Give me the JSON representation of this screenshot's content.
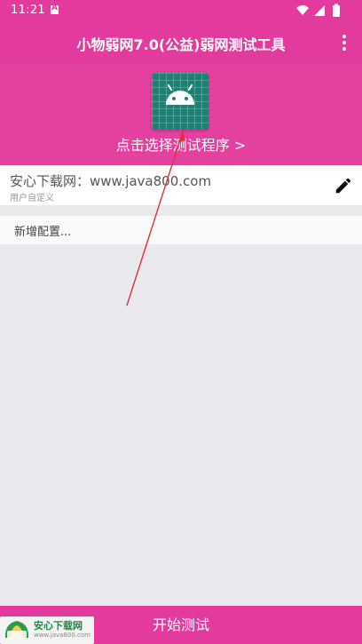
{
  "status_bar": {
    "time": "11:21",
    "icons": [
      "notification-icon",
      "wifi-icon",
      "signal-icon",
      "battery-icon"
    ]
  },
  "toolbar": {
    "title": "小物弱网7.0(公益)弱网测试工具",
    "menu_icon": "more-vert-icon"
  },
  "header": {
    "app_icon": "android-icon",
    "select_label": "点击选择测试程序 >"
  },
  "config": {
    "name": "安心下载网：www.java800.com",
    "subtitle": "用户自定义",
    "edit_icon": "pencil-icon"
  },
  "add_config": {
    "label": "新增配置..."
  },
  "footer": {
    "start_label": "开始测试"
  },
  "watermark": {
    "name": "安心下载网",
    "url": "www.java800.com"
  },
  "colors": {
    "primary": "#e33a9e",
    "header_bg": "#e4409f",
    "page_bg": "#e9e9ee",
    "app_icon_bg": "#1e7f72",
    "arrow": "#e0303a"
  }
}
